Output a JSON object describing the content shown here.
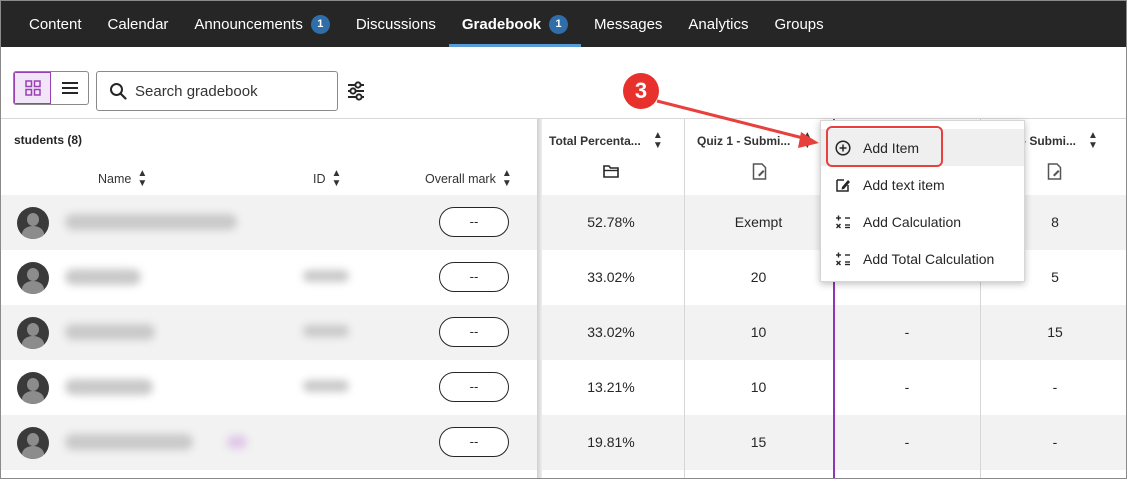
{
  "nav": {
    "tabs": [
      {
        "label": "Content"
      },
      {
        "label": "Calendar"
      },
      {
        "label": "Announcements",
        "count": "1"
      },
      {
        "label": "Discussions"
      },
      {
        "label": "Gradebook",
        "count": "1",
        "active": true
      },
      {
        "label": "Messages"
      },
      {
        "label": "Analytics"
      },
      {
        "label": "Groups"
      }
    ]
  },
  "toolbar": {
    "search_placeholder": "Search gradebook",
    "view_modes": [
      "grid-view-icon",
      "list-view-icon"
    ]
  },
  "table": {
    "students_label": "students (8)",
    "headers": {
      "name": "Name",
      "id": "ID",
      "overall": "Overall mark",
      "total": "Total Percenta...",
      "quiz1": "Quiz 1 - Submi...",
      "quiz2": "2 - Submi..."
    },
    "rows": [
      {
        "overall": "--",
        "total": "52.78%",
        "quiz1": "Exempt",
        "col3": "",
        "quiz2": "8"
      },
      {
        "overall": "--",
        "total": "33.02%",
        "quiz1": "20",
        "col3": "",
        "quiz2": "5"
      },
      {
        "overall": "--",
        "total": "33.02%",
        "quiz1": "10",
        "col3": "-",
        "quiz2": "15"
      },
      {
        "overall": "--",
        "total": "13.21%",
        "quiz1": "10",
        "col3": "-",
        "quiz2": "-"
      },
      {
        "overall": "--",
        "total": "19.81%",
        "quiz1": "15",
        "col3": "-",
        "quiz2": "-"
      }
    ]
  },
  "menu": {
    "items": [
      {
        "label": "Add Item",
        "icon": "plus-circle-icon"
      },
      {
        "label": "Add text item",
        "icon": "text-item-icon"
      },
      {
        "label": "Add Calculation",
        "icon": "calculation-icon"
      },
      {
        "label": "Add Total Calculation",
        "icon": "total-calculation-icon"
      }
    ]
  },
  "annotation": {
    "step": "3",
    "color": "#e8312c"
  },
  "colors": {
    "nav_bg": "#262626",
    "accent": "#8f35b5",
    "badge": "#2f6ea8",
    "highlight": "#e8413d"
  }
}
